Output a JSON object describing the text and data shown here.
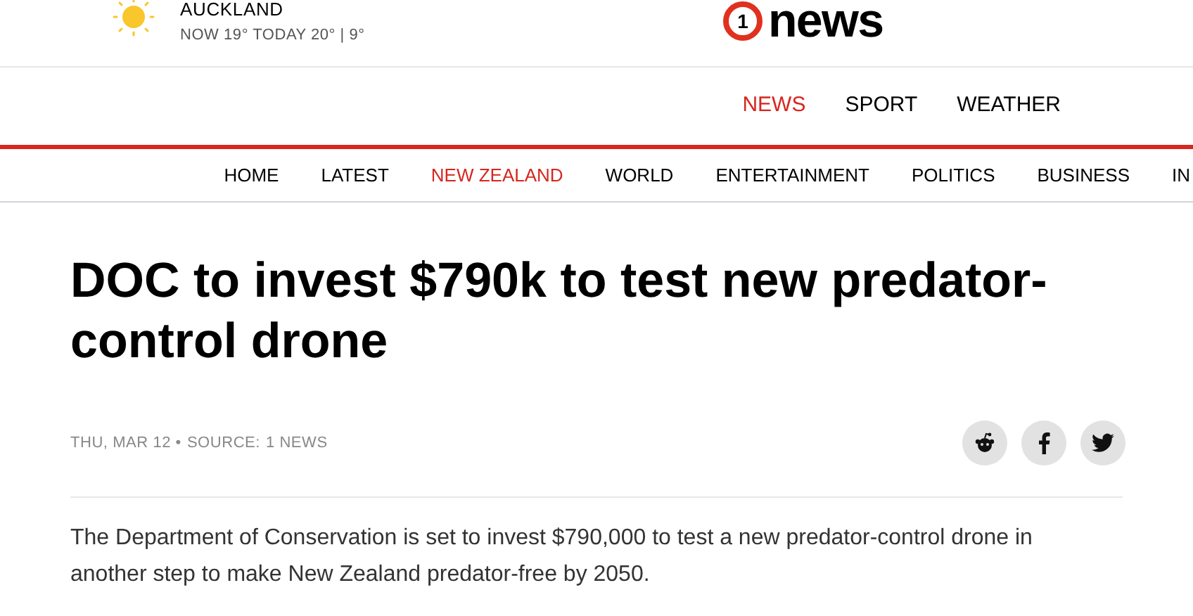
{
  "weather": {
    "city": "AUCKLAND",
    "summary": "NOW 19° TODAY 20° | 9°"
  },
  "logo": {
    "number": "1",
    "word": "news"
  },
  "sections": [
    {
      "label": "NEWS",
      "selected": true
    },
    {
      "label": "SPORT",
      "selected": false
    },
    {
      "label": "WEATHER",
      "selected": false
    }
  ],
  "nav": [
    {
      "label": "HOME",
      "selected": false
    },
    {
      "label": "LATEST",
      "selected": false
    },
    {
      "label": "NEW ZEALAND",
      "selected": true
    },
    {
      "label": "WORLD",
      "selected": false
    },
    {
      "label": "ENTERTAINMENT",
      "selected": false
    },
    {
      "label": "POLITICS",
      "selected": false
    },
    {
      "label": "BUSINESS",
      "selected": false
    },
    {
      "label": "IN",
      "selected": false
    }
  ],
  "article": {
    "headline": "DOC to invest $790k to test new predator-control drone",
    "date": "THU, MAR 12 •",
    "source_label": "SOURCE:",
    "source": "1 NEWS",
    "share": [
      {
        "kind": "reddit"
      },
      {
        "kind": "facebook"
      },
      {
        "kind": "twitter"
      }
    ],
    "body": "The Department of Conservation is set to invest $790,000 to test a new predator-control drone in another step to make New Zealand predator-free by 2050."
  }
}
